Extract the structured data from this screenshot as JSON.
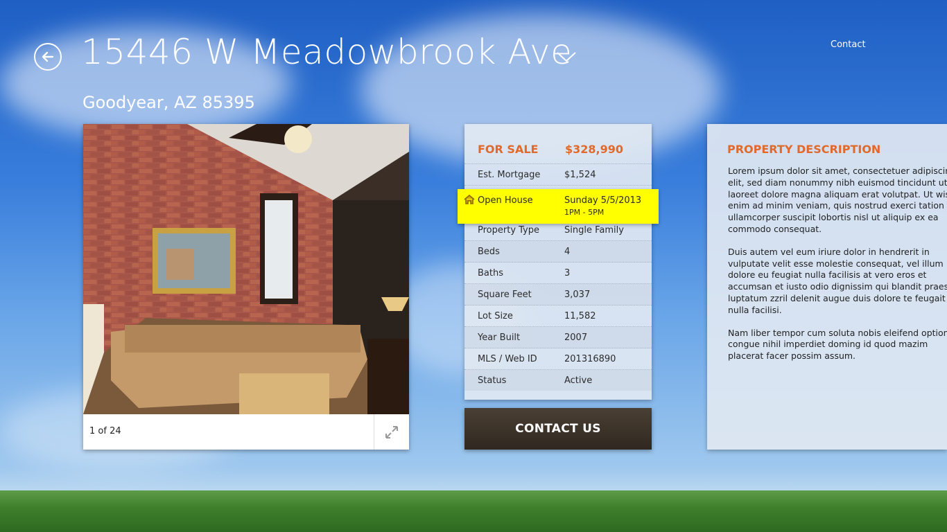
{
  "header": {
    "title": "15446 W Meadowbrook Ave",
    "subtitle": "Goodyear, AZ 85395",
    "contact_link": "Contact"
  },
  "photo": {
    "counter": "1 of 24"
  },
  "listing": {
    "status_label": "FOR SALE",
    "price": "$328,990",
    "rows": [
      {
        "label": "Est. Mortgage",
        "value": "$1,524"
      },
      {
        "label": "Property Type",
        "value": "Single Family"
      },
      {
        "label": "Beds",
        "value": "4"
      },
      {
        "label": "Baths",
        "value": "3"
      },
      {
        "label": "Square Feet",
        "value": "3,037"
      },
      {
        "label": "Lot Size",
        "value": "11,582"
      },
      {
        "label": "Year Built",
        "value": "2007"
      },
      {
        "label": "MLS / Web ID",
        "value": "201316890"
      },
      {
        "label": "Status",
        "value": "Active"
      }
    ],
    "open_house": {
      "label": "Open House",
      "date": "Sunday 5/5/2013",
      "time": "1PM - 5PM",
      "icon": "house-icon"
    }
  },
  "contact_button": "CONTACT US",
  "description": {
    "title": "PROPERTY DESCRIPTION",
    "paragraphs": [
      "Lorem ipsum dolor sit amet, consectetuer adipiscing elit, sed diam nonummy nibh euismod tincidunt ut laoreet dolore magna aliquam erat volutpat. Ut wisi enim ad minim veniam, quis nostrud exerci tation ullamcorper suscipit lobortis nisl ut aliquip ex ea commodo consequat.",
      "Duis autem vel eum iriure dolor in hendrerit in vulputate velit esse molestie consequat, vel illum dolore eu feugiat nulla facilisis at vero eros et accumsan et iusto odio dignissim qui blandit praesent luptatum zzril delenit augue duis dolore te feugait nulla facilisi.",
      "Nam liber tempor cum soluta nobis eleifend option congue nihil imperdiet doming id quod mazim placerat facer possim assum."
    ]
  },
  "colors": {
    "accent": "#e06a2b",
    "highlight": "#ffff00",
    "button": "#3b3228"
  }
}
